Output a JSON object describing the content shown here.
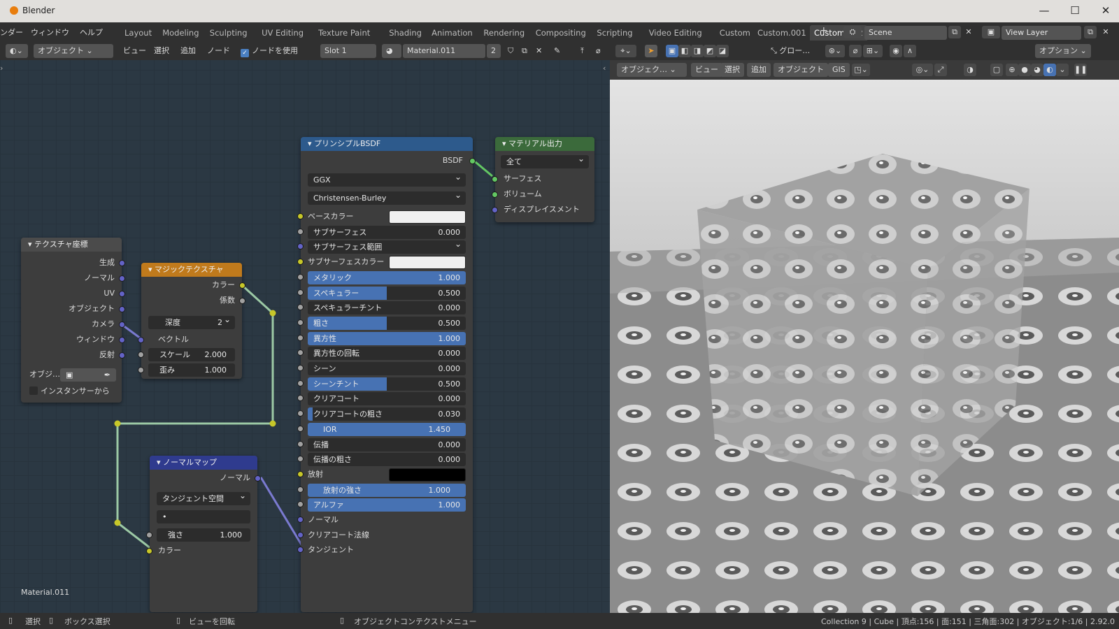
{
  "app_title": "Blender",
  "menus": [
    "ンダー",
    "ウィンドウ",
    "ヘルプ"
  ],
  "workspaces": [
    "Layout",
    "Modeling",
    "Sculpting",
    "UV Editing",
    "Texture Paint",
    "Shading",
    "Animation",
    "Rendering",
    "Compositing",
    "Scripting",
    "Video Editing",
    "Custom",
    "Custom.001",
    "Custom.002"
  ],
  "active_workspace": "Custom.002",
  "scene": "Scene",
  "view_layer": "View Layer",
  "node_header": {
    "object_mode": "オブジェクト",
    "view": "ビュー",
    "select": "選択",
    "add": "追加",
    "node": "ノード",
    "use_nodes": "ノードを使用",
    "slot": "Slot 1",
    "material": "Material.011",
    "users": "2"
  },
  "viewport_header": {
    "transform": "グロー…",
    "options": "オプション"
  },
  "viewport_sub": {
    "mode": "オブジェク…",
    "view": "ビュー",
    "select": "選択",
    "add": "追加",
    "object": "オブジェクト",
    "gis": "GIS"
  },
  "material_label": "Material.011",
  "nodes": {
    "texcoord": {
      "title": "テクスチャ座標",
      "outputs": [
        "生成",
        "ノーマル",
        "UV",
        "オブジェクト",
        "カメラ",
        "ウィンドウ",
        "反射"
      ],
      "object_label": "オブジ…",
      "instancer": "インスタンサーから"
    },
    "magic": {
      "title": "マジックテクスチャ",
      "outputs": [
        "カラー",
        "係数"
      ],
      "depth_label": "深度",
      "depth": "2",
      "vector": "ベクトル",
      "scale_label": "スケール",
      "scale": "2.000",
      "distortion_label": "歪み",
      "distortion": "1.000"
    },
    "normalmap": {
      "title": "ノーマルマップ",
      "output": "ノーマル",
      "space": "タンジェント空間",
      "uv": "•",
      "strength_label": "強さ",
      "strength": "1.000",
      "color": "カラー"
    },
    "bsdf": {
      "title": "プリンシプルBSDF",
      "output": "BSDF",
      "distribution": "GGX",
      "subsurface_method": "Christensen-Burley",
      "rows": [
        {
          "label": "ベースカラー",
          "type": "color",
          "color": "#f0f0f0",
          "sock": "y"
        },
        {
          "label": "サブサーフェス",
          "value": "0.000",
          "fill": 0,
          "sock": "g"
        },
        {
          "label": "サブサーフェス範囲",
          "type": "dd",
          "sock": "p"
        },
        {
          "label": "サブサーフェスカラー",
          "type": "color",
          "color": "#f0f0f0",
          "sock": "y"
        },
        {
          "label": "メタリック",
          "value": "1.000",
          "fill": 1,
          "sock": "g"
        },
        {
          "label": "スペキュラー",
          "value": "0.500",
          "fill": 0.5,
          "sock": "g"
        },
        {
          "label": "スペキュラーチント",
          "value": "0.000",
          "fill": 0,
          "sock": "g"
        },
        {
          "label": "粗さ",
          "value": "0.500",
          "fill": 0.5,
          "sock": "g"
        },
        {
          "label": "異方性",
          "value": "1.000",
          "fill": 1,
          "sock": "g"
        },
        {
          "label": "異方性の回転",
          "value": "0.000",
          "fill": 0,
          "sock": "g"
        },
        {
          "label": "シーン",
          "value": "0.000",
          "fill": 0,
          "sock": "g"
        },
        {
          "label": "シーンチント",
          "value": "0.500",
          "fill": 0.5,
          "sock": "g"
        },
        {
          "label": "クリアコート",
          "value": "0.000",
          "fill": 0,
          "sock": "g"
        },
        {
          "label": "クリアコートの粗さ",
          "value": "0.030",
          "fill": 0.03,
          "sock": "g"
        },
        {
          "label": "IOR",
          "value": "1.450",
          "fill": 1,
          "sock": "g",
          "center": true
        },
        {
          "label": "伝播",
          "value": "0.000",
          "fill": 0,
          "sock": "g"
        },
        {
          "label": "伝播の粗さ",
          "value": "0.000",
          "fill": 0,
          "sock": "g"
        },
        {
          "label": "放射",
          "type": "color",
          "color": "#000000",
          "sock": "y"
        },
        {
          "label": "放射の強さ",
          "value": "1.000",
          "fill": 1,
          "sock": "g",
          "center": true
        },
        {
          "label": "アルファ",
          "value": "1.000",
          "fill": 1,
          "sock": "g"
        },
        {
          "label": "ノーマル",
          "type": "plain",
          "sock": "p"
        },
        {
          "label": "クリアコート法線",
          "type": "plain",
          "sock": "p"
        },
        {
          "label": "タンジェント",
          "type": "plain",
          "sock": "p"
        }
      ]
    },
    "output": {
      "title": "マテリアル出力",
      "target": "全て",
      "inputs": [
        "サーフェス",
        "ボリューム",
        "ディスプレイスメント"
      ]
    }
  },
  "status": {
    "select": "選択",
    "box_select": "ボックス選択",
    "rotate": "ビューを回転",
    "context": "オブジェクトコンテクストメニュー",
    "stats": "Collection 9 | Cube | 頂点:156 | 面:151 | 三角面:302 | オブジェクト:1/6 | 2.92.0"
  },
  "colors": {
    "node_bg": "#2b3843",
    "bsdf_header": "#2d5a8c",
    "output_header": "#3b6a3b",
    "magic_header": "#c07a1c",
    "normal_header": "#2f3b8e",
    "texcoord_header": "#3d3d3d",
    "accent": "#4772b3"
  }
}
